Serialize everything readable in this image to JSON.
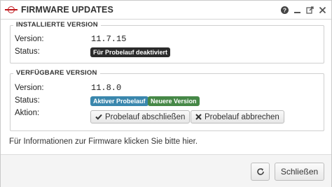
{
  "window": {
    "title": "FIRMWARE UPDATES"
  },
  "titlebar_icons": [
    "help-icon",
    "minimize-icon",
    "popout-icon",
    "close-icon"
  ],
  "installed": {
    "legend": "INSTALLIERTE VERSION",
    "version_label": "Version:",
    "version_value": "11.7.15",
    "status_label": "Status:",
    "status_badge": "Für Probelauf deaktiviert"
  },
  "available": {
    "legend": "VERFÜGBARE VERSION",
    "version_label": "Version:",
    "version_value": "11.8.0",
    "status_label": "Status:",
    "status_badges": [
      "Aktiver Probelauf",
      "Neuere Version"
    ],
    "action_label": "Aktion:",
    "actions": [
      "Probelauf abschließen",
      "Probelauf abbrechen"
    ]
  },
  "info_text": "Für Informationen zur Firmware klicken Sie bitte hier.",
  "footer": {
    "close_label": "Schließen"
  },
  "colors": {
    "badge_dark": "#2b2b2b",
    "badge_blue": "#3a87ad",
    "badge_green": "#468847",
    "logo_red": "#c0161b"
  }
}
